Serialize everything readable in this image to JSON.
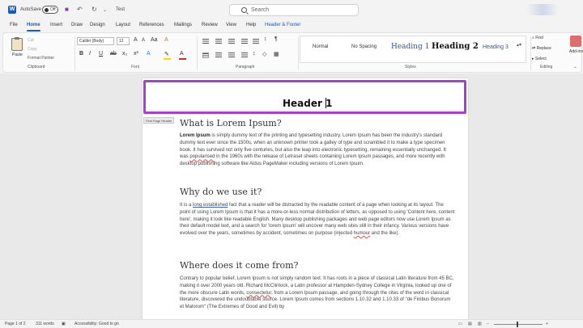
{
  "title_bar": {
    "autosave_label": "AutoSave",
    "autosave_state": "Off",
    "doc_title": "Test",
    "search_placeholder": "Search"
  },
  "menu": {
    "items": [
      "File",
      "Home",
      "Insert",
      "Draw",
      "Design",
      "Layout",
      "References",
      "Mailings",
      "Review",
      "View",
      "Help",
      "Header & Footer"
    ],
    "active": "Home"
  },
  "ribbon": {
    "clipboard": {
      "paste_label": "Paste",
      "cut_label": "Cut",
      "copy_label": "Copy",
      "format_painter_label": "Format Painter",
      "group_label": "Clipboard"
    },
    "font": {
      "font_name": "Calibri (Body)",
      "font_size": "12",
      "group_label": "Font",
      "buttons": [
        "B",
        "I",
        "U",
        "ab",
        "x₂",
        "x²",
        "A"
      ]
    },
    "paragraph": {
      "group_label": "Paragraph",
      "pilcrow": "¶"
    },
    "styles": {
      "group_label": "Styles",
      "items": [
        "Normal",
        "No Spacing",
        "Heading 1",
        "Heading 2",
        "Heading 3"
      ]
    },
    "editing": {
      "group_label": "Editing",
      "find_label": "Find",
      "replace_label": "Replace",
      "select_label": "Select"
    },
    "addins_label": "Add-ins"
  },
  "document": {
    "header_text": "Header 1",
    "header_tag": "First Page Header",
    "sections": [
      {
        "heading": "What is Lorem Ipsum?",
        "lead": "Lorem Ipsum",
        "body": " is simply dummy text of the printing and typesetting industry. Lorem Ipsum has been the industry's standard dummy text ever since the 1500s, when an unknown printer took a galley of type and scrambled it to make a type specimen book. It has survived not only five centuries, but also the leap into electronic typesetting, remaining essentially unchanged. It was ",
        "marked": "popularised",
        "tail": " in the 1960s with the release of Letraset sheets containing Lorem Ipsum passages, and more recently with desktop publishing software like Aldus PageMaker including versions of Lorem Ipsum."
      },
      {
        "heading": "Why do we use it?",
        "pre": "It is a ",
        "marked": "long established",
        "body": " fact that a reader will be distracted by the readable content of a page when looking at its layout. The point of using Lorem Ipsum is that it has a more-or-less normal distribution of letters, as opposed to using 'Content here, content here', making it look like readable English. Many desktop publishing packages and web page editors now use Lorem Ipsum as their default model text, and a search for 'lorem ipsum' will uncover many web sites still in their infancy. Various versions have evolved over the years, sometimes by accident, sometimes on purpose (injected ",
        "marked2": "humour",
        "tail": " and the like)."
      },
      {
        "heading": "Where does it come from?",
        "body": "Contrary to popular belief, Lorem Ipsum is not simply random text. It has roots in a piece of classical Latin literature from 45 BC, making it over 2000 years old. Richard McClintock, a Latin professor at Hampden-Sydney College in Virginia, looked up one of the more obscure Latin words, ",
        "marked": "consectetur",
        "tail": ", from a Lorem Ipsum passage, and going through the cites of the word in classical literature, discovered the undoubtable source. Lorem Ipsum comes from sections 1.10.32 and 1.10.33 of \"de Finibus Bonorum et Malorum\" (The Extremes of Good and Evil) by"
      }
    ]
  },
  "status_bar": {
    "page": "Page 1 of 2",
    "words": "311 words",
    "accessibility": "Accessibility: Good to go"
  }
}
